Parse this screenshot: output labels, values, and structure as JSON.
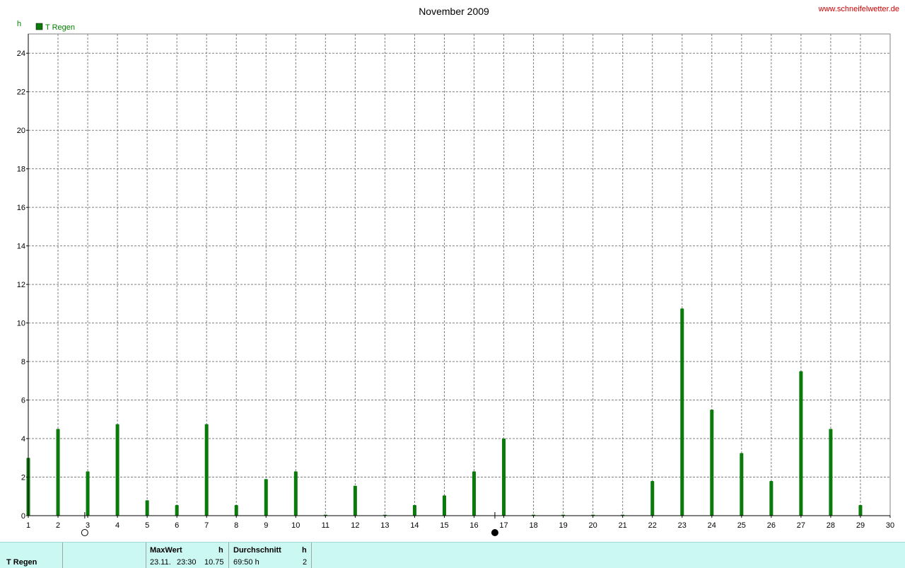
{
  "website": "www.schneifelwetter.de",
  "chart_data": {
    "type": "bar",
    "title": "November 2009",
    "ylabel": "h",
    "ylim": [
      0,
      25
    ],
    "yticks": [
      0,
      2,
      4,
      6,
      8,
      10,
      12,
      14,
      16,
      18,
      20,
      22,
      24
    ],
    "xlim": [
      1,
      30
    ],
    "xticks": [
      1,
      2,
      3,
      4,
      5,
      6,
      7,
      8,
      9,
      10,
      11,
      12,
      13,
      14,
      15,
      16,
      17,
      18,
      19,
      20,
      21,
      22,
      23,
      24,
      25,
      26,
      27,
      28,
      29,
      30
    ],
    "grid": true,
    "legend_position": "top-left",
    "series": [
      {
        "name": "T Regen",
        "color": "#0a7a0a",
        "days": [
          1,
          2,
          3,
          4,
          5,
          6,
          7,
          8,
          9,
          10,
          11,
          12,
          13,
          14,
          15,
          16,
          17,
          18,
          19,
          20,
          21,
          22,
          23,
          24,
          25,
          26,
          27,
          28,
          29
        ],
        "values": [
          3.0,
          4.5,
          2.3,
          4.75,
          0.8,
          0.55,
          4.75,
          0.55,
          1.9,
          2.3,
          0.05,
          1.55,
          0.05,
          0.55,
          1.05,
          2.3,
          4.0,
          0.05,
          0.05,
          0.05,
          0.05,
          1.8,
          10.75,
          5.5,
          3.25,
          1.8,
          7.5,
          4.5,
          0.55
        ]
      }
    ],
    "moon_phases": [
      {
        "day": 2.9,
        "phase": "full-moon"
      },
      {
        "day": 16.7,
        "phase": "new-moon"
      }
    ]
  },
  "stats": {
    "series_label": "T Regen",
    "max_header": "MaxWert",
    "max_unit": "h",
    "max_date": "23.11.",
    "max_time": "23:30",
    "max_value": "10.75",
    "avg_header": "Durchschnitt",
    "avg_unit": "h",
    "avg_value": "69:50 h",
    "avg_extra": "2"
  }
}
